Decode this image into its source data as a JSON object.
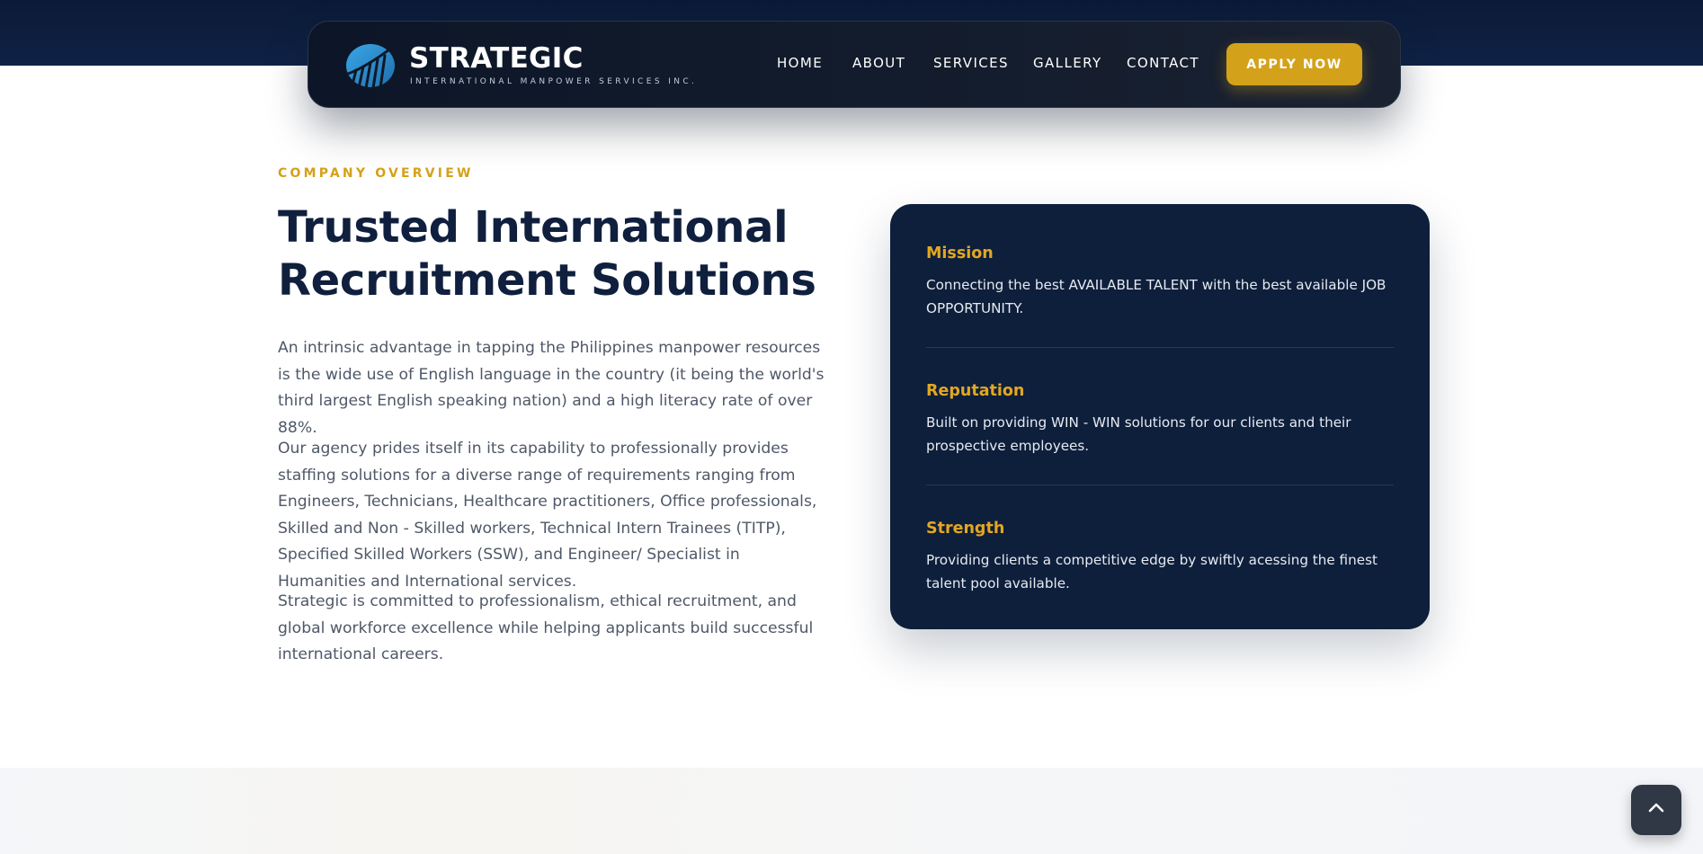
{
  "brand": {
    "name": "STRATEGIC",
    "tagline": "INTERNATIONAL MANPOWER SERVICES INC."
  },
  "nav": {
    "links": [
      "HOME",
      "ABOUT",
      "SERVICES",
      "GALLERY",
      "CONTACT"
    ],
    "cta": "APPLY NOW"
  },
  "overview": {
    "eyebrow": "COMPANY OVERVIEW",
    "title": "Trusted International Recruitment Solutions",
    "paragraphs": [
      "An intrinsic advantage in tapping the Philippines manpower resources is the wide use of English language in the country (it being the world's third largest English speaking nation) and a high literacy rate of over 88%.",
      "Our agency prides itself in its capability to professionally provides staffing solutions for a diverse range of requirements ranging from Engineers, Technicians, Healthcare practitioners, Office professionals, Skilled and Non - Skilled workers, Technical Intern Trainees (TITP), Specified Skilled Workers (SSW), and Engineer/ Specialist in Humanities and International services.",
      "Strategic is committed to professionalism, ethical recruitment, and global workforce excellence while helping applicants build successful international careers."
    ]
  },
  "values": [
    {
      "title": "Mission",
      "text": "Connecting the best AVAILABLE TALENT with the best available JOB OPPORTUNITY."
    },
    {
      "title": "Reputation",
      "text": "Built on providing WIN - WIN solutions for our clients and their prospective employees."
    },
    {
      "title": "Strength",
      "text": "Providing clients a competitive edge by swiftly acessing the finest talent pool available."
    }
  ],
  "icons": {
    "logo": "stylized-globe-with-rising-bars-logo",
    "scroll_top": "chevron-up-icon"
  },
  "colors": {
    "navy": "#0e1f3b",
    "gold": "#d4a11a",
    "logo_blue": "#2d8fd0"
  }
}
